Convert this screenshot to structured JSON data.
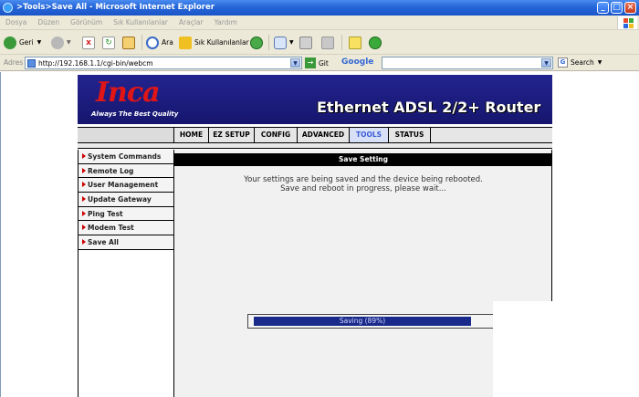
{
  "window": {
    "title": ">Tools>Save All - Microsoft Internet Explorer",
    "buttons": {
      "minimize": "_",
      "maximize": "□",
      "close": "×"
    }
  },
  "menu": [
    "Dosya",
    "Düzen",
    "Görünüm",
    "Sık Kullanılanlar",
    "Araçlar",
    "Yardım"
  ],
  "toolbar": {
    "back_label": "Geri",
    "search_label": "Ara",
    "favorites_label": "Sık Kullanılanlar"
  },
  "address": {
    "label": "Adres",
    "url": "http://192.168.1.1/cgi-bin/webcm",
    "go_label": "Git",
    "google_label": "Google",
    "search_label": "Search"
  },
  "router": {
    "logo": "Inca",
    "slogan": "Always The Best Quality",
    "product": "Ethernet ADSL 2/2+ Router",
    "nav": [
      "HOME",
      "EZ SETUP",
      "CONFIG",
      "ADVANCED",
      "TOOLS",
      "STATUS"
    ],
    "active_nav": "TOOLS",
    "sidebar": [
      "System Commands",
      "Remote Log",
      "User Management",
      "Update Gateway",
      "Ping Test",
      "Modem Test",
      "Save All"
    ],
    "content_header": "Save Setting",
    "message_line1": "Your settings are being saved and the device being rebooted.",
    "message_line2": "Save and reboot in progress, please wait...",
    "progress_label": "Saving (89%)",
    "progress_fraction": 0.89
  },
  "colors": {
    "banner_bg": "#1a1a8a",
    "logo_red": "#e01616",
    "progress_fill": "#1a2a8a",
    "active_nav": "#3a5cd6"
  }
}
